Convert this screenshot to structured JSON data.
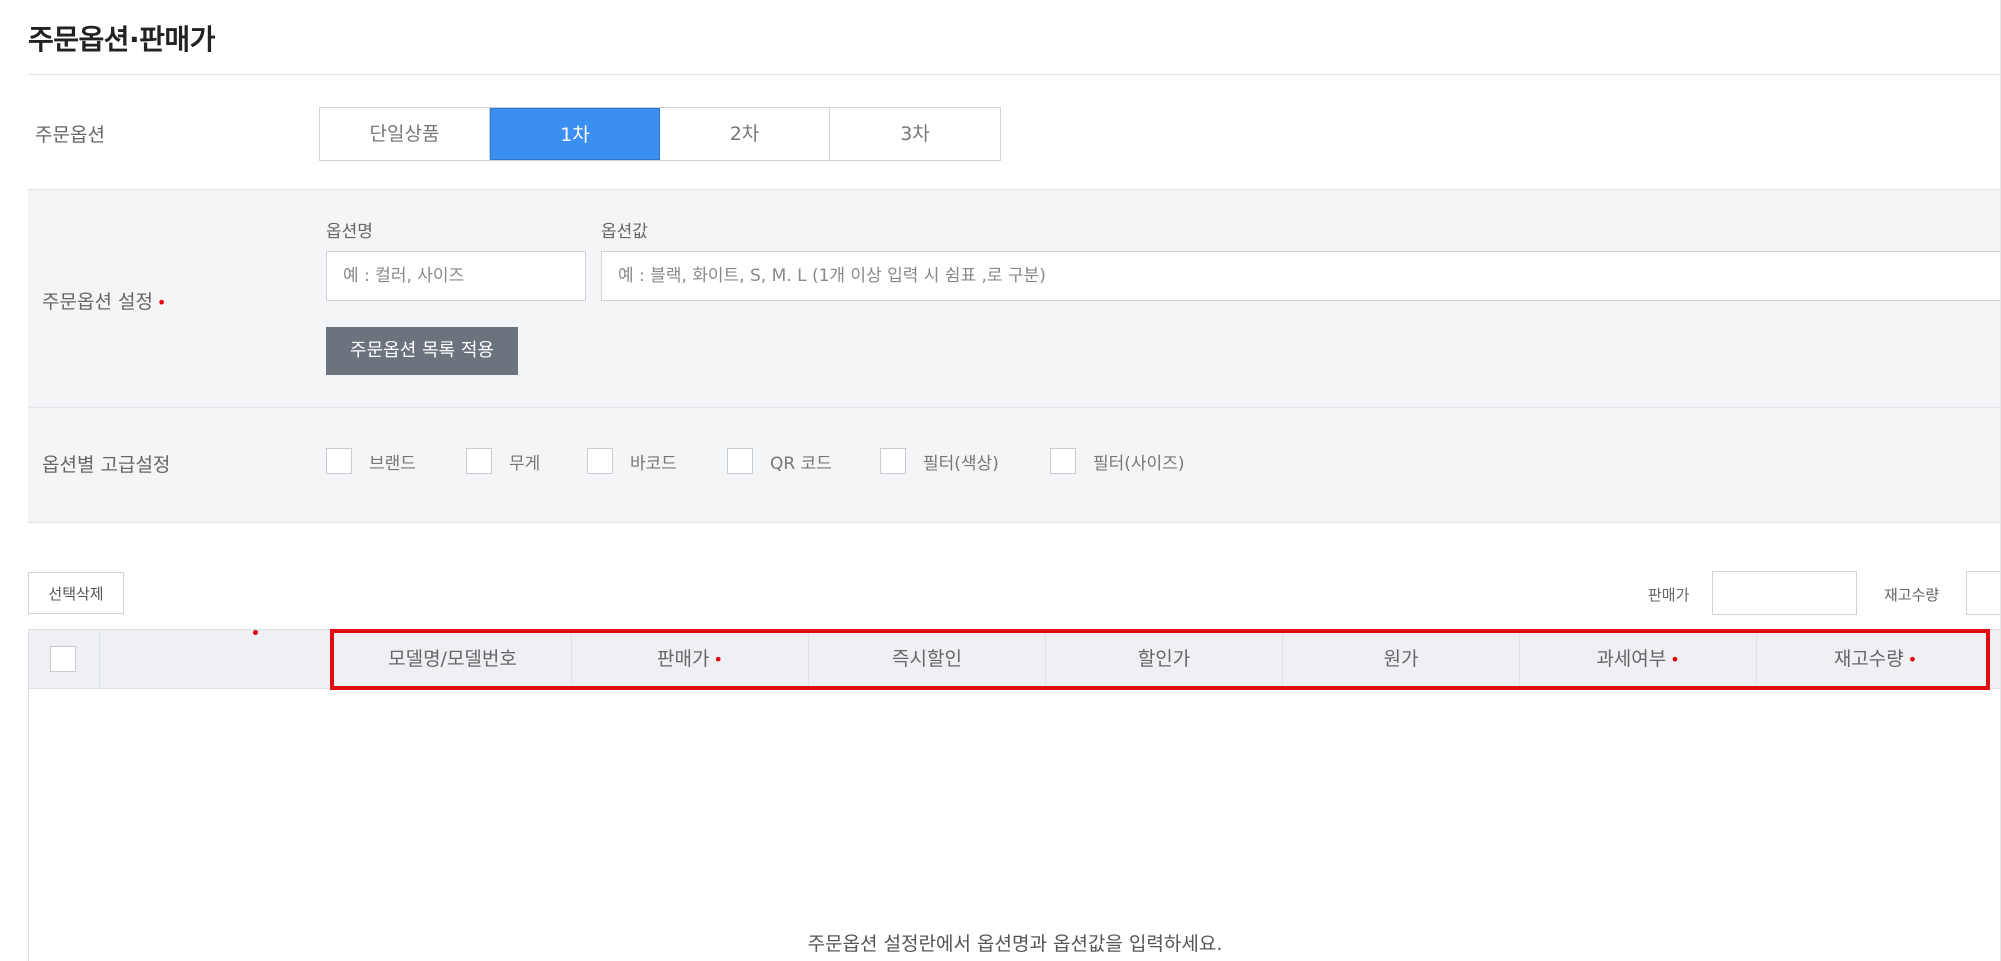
{
  "page_title": "주문옵션·판매가",
  "order_option": {
    "label": "주문옵션",
    "segments": [
      {
        "label": "단일상품",
        "active": false
      },
      {
        "label": "1차",
        "active": true
      },
      {
        "label": "2차",
        "active": false
      },
      {
        "label": "3차",
        "active": false
      }
    ]
  },
  "option_setting": {
    "label": "주문옵션 설정",
    "required_mark": "•",
    "name_label": "옵션명",
    "name_placeholder": "예 : 컬러, 사이즈",
    "value_label": "옵션값",
    "value_placeholder": "예 : 블랙, 화이트, S, M. L (1개 이상 입력 시 쉼표 ,로 구분)",
    "apply_button": "주문옵션 목록 적용"
  },
  "advanced": {
    "label": "옵션별 고급설정",
    "checkboxes": [
      {
        "label": "브랜드",
        "checked": false
      },
      {
        "label": "무게",
        "checked": false
      },
      {
        "label": "바코드",
        "checked": false
      },
      {
        "label": "QR 코드",
        "checked": false
      },
      {
        "label": "필터(색상)",
        "checked": false
      },
      {
        "label": "필터(사이즈)",
        "checked": false
      }
    ]
  },
  "toolbar": {
    "delete_button": "선택삭제",
    "price_label": "판매가",
    "stock_label": "재고수량"
  },
  "table": {
    "columns": [
      {
        "label": "모델명/모델번호",
        "required": false
      },
      {
        "label": "판매가",
        "required": true
      },
      {
        "label": "즉시할인",
        "required": false
      },
      {
        "label": "할인가",
        "required": false
      },
      {
        "label": "원가",
        "required": false
      },
      {
        "label": "과세여부",
        "required": true
      },
      {
        "label": "재고수량",
        "required": true
      }
    ],
    "required_mark": "•",
    "empty_message": "주문옵션 설정란에서 옵션명과 옵션값을 입력하세요."
  },
  "colors": {
    "accent": "#3b8ff0",
    "required": "#e5000b",
    "highlight": "#e00a12"
  }
}
